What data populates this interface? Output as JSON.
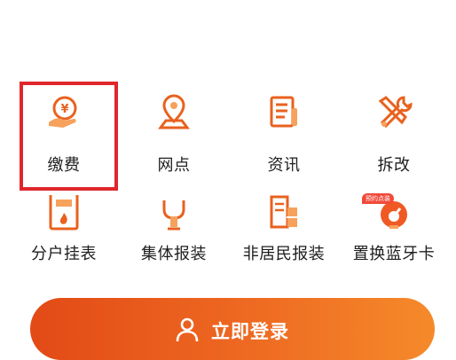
{
  "colors": {
    "accent": "#ee6a22",
    "accent_dark": "#d9481a",
    "highlight_border": "#e0262c",
    "text": "#1e1e1e"
  },
  "services": {
    "row1": [
      {
        "label": "缴费",
        "icon": "payment-icon"
      },
      {
        "label": "网点",
        "icon": "location-icon"
      },
      {
        "label": "资讯",
        "icon": "news-icon"
      },
      {
        "label": "拆改",
        "icon": "tools-icon"
      }
    ],
    "row2": [
      {
        "label": "分户挂表",
        "icon": "meter-icon"
      },
      {
        "label": "集体报装",
        "icon": "pipe-icon"
      },
      {
        "label": "非居民报装",
        "icon": "building-icon"
      },
      {
        "label": "置换蓝牙卡",
        "icon": "gauge-icon",
        "badge": "预约点装"
      }
    ]
  },
  "login": {
    "label": "立即登录",
    "icon": "user-icon"
  }
}
